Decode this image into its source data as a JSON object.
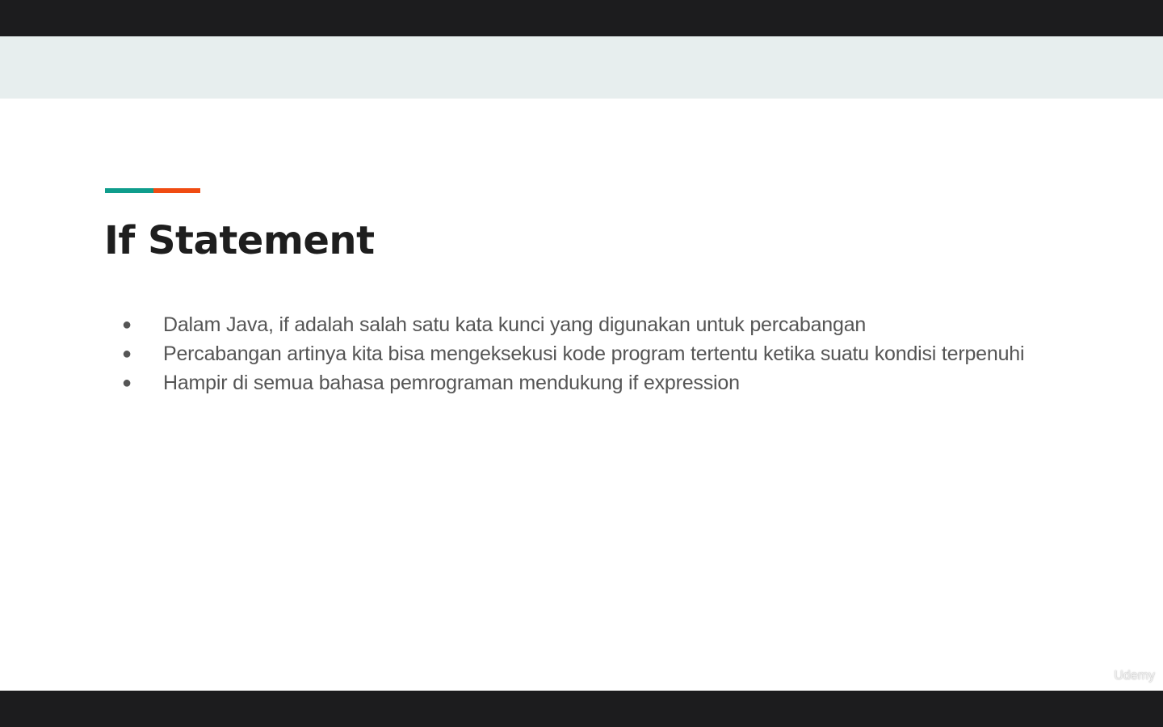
{
  "slide": {
    "title": "If Statement",
    "accent_colors": [
      "#0f9d8c",
      "#f04b12"
    ],
    "bullets": [
      "Dalam Java, if adalah salah satu kata kunci yang digunakan untuk percabangan",
      "Percabangan artinya kita bisa mengeksekusi kode program tertentu ketika suatu kondisi terpenuhi",
      "Hampir di semua bahasa pemrograman mendukung if expression"
    ],
    "bullet_glyph": "●"
  },
  "player": {
    "watermark": "Udemy"
  }
}
